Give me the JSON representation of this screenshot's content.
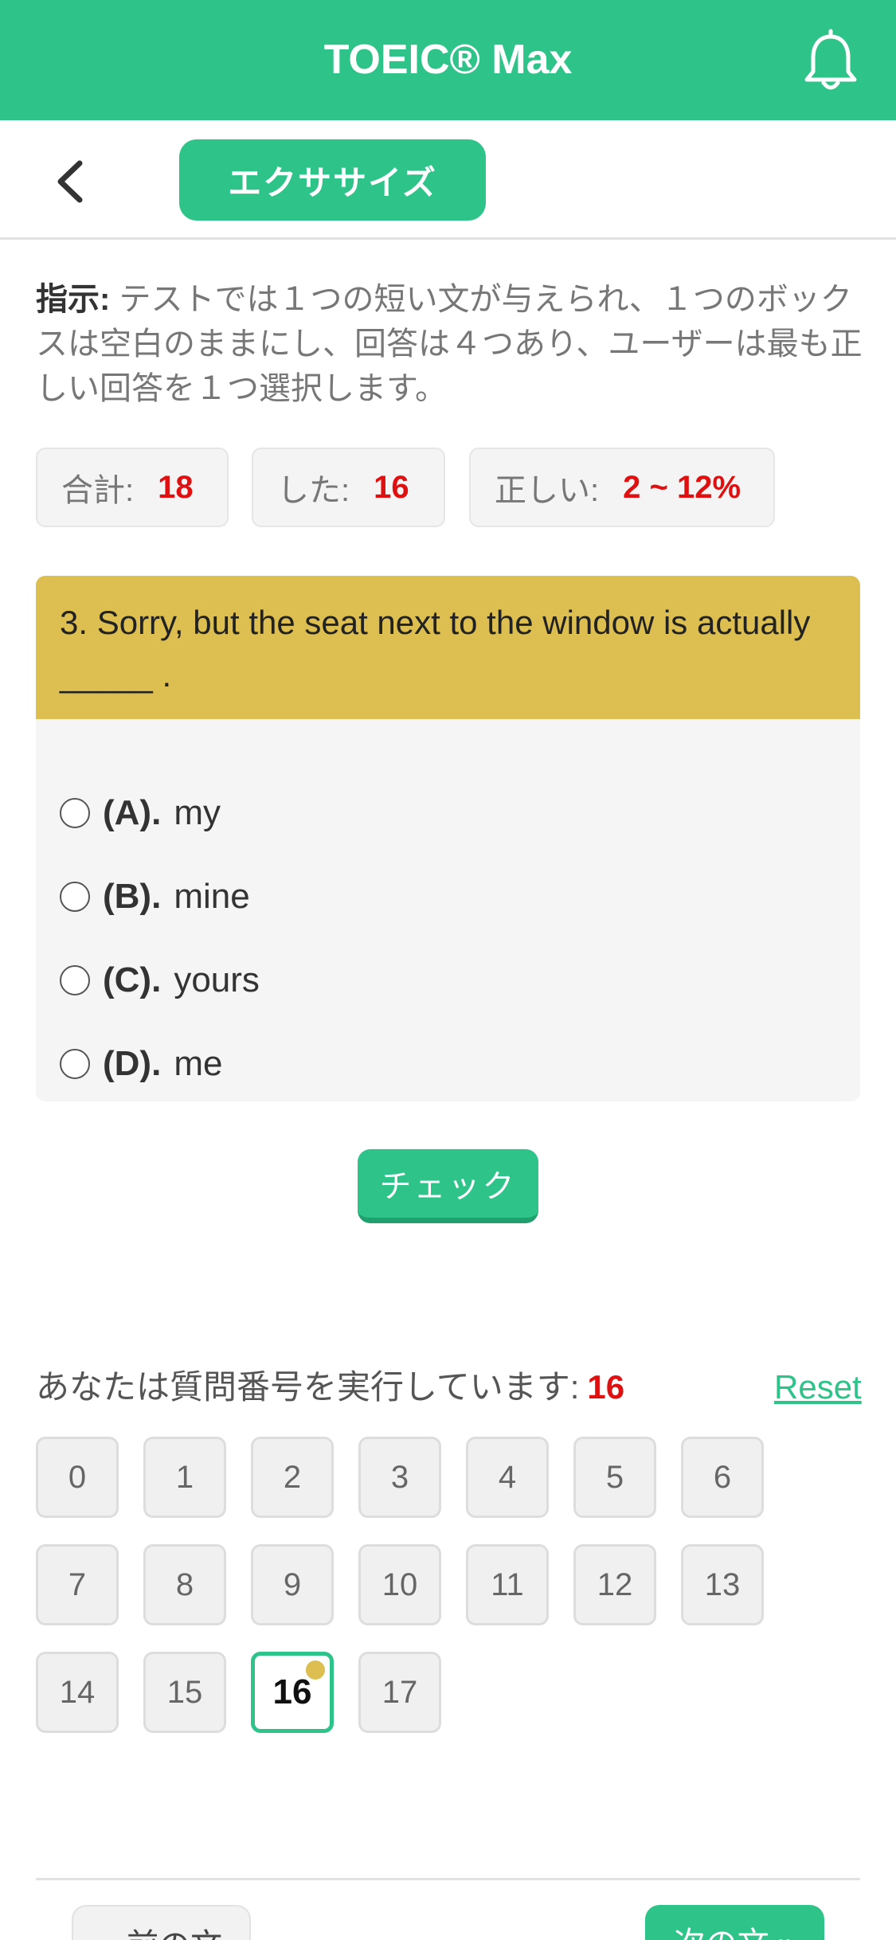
{
  "header": {
    "title": "TOEIC® Max",
    "bell_icon": "bell-icon"
  },
  "subbar": {
    "back_icon": "chevron-left-icon",
    "tab_label": "エクササイズ"
  },
  "instructions": {
    "label": "指示:",
    "text": " テストでは１つの短い文が与えられ、１つのボックスは空白のままにし、回答は４つあり、ユーザーは最も正しい回答を１つ選択します。"
  },
  "stats": {
    "total_label": "合計:",
    "total_value": "18",
    "done_label": "した:",
    "done_value": "16",
    "correct_label": "正しい:",
    "correct_value": "2 ~ 12%"
  },
  "question": {
    "text": "3. Sorry, but the seat next to the window is actually _____ .",
    "options": [
      {
        "label": "(A).",
        "text": "my"
      },
      {
        "label": "(B).",
        "text": "mine"
      },
      {
        "label": "(C).",
        "text": "yours"
      },
      {
        "label": "(D).",
        "text": "me"
      }
    ]
  },
  "check_label": "チェック",
  "navigator": {
    "running_label": "あなたは質問番号を実行しています:",
    "current": "16",
    "reset_label": "Reset",
    "numbers": [
      "0",
      "1",
      "2",
      "3",
      "4",
      "5",
      "6",
      "7",
      "8",
      "9",
      "10",
      "11",
      "12",
      "13",
      "14",
      "15",
      "16",
      "17"
    ]
  },
  "footer": {
    "prev_label": "« 前の文",
    "next_label": "次の文 »"
  },
  "colors": {
    "brand": "#2ec388",
    "question_header": "#dcbf50",
    "highlight": "#e01010"
  }
}
